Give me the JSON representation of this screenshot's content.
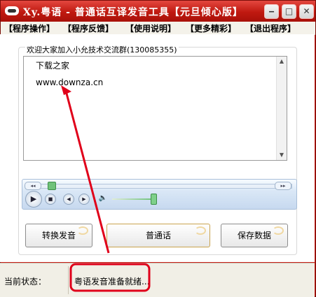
{
  "window": {
    "title": "Xy.粤语 - 普通话互译发音工具【元旦倾心版】",
    "minimize": "‒",
    "maximize": "□",
    "close": "✕"
  },
  "menu": {
    "items": [
      {
        "label": "【程序操作】"
      },
      {
        "label": "【程序反馈】"
      },
      {
        "label": "【使用说明】"
      },
      {
        "label": "【更多精彩】"
      },
      {
        "label": "【退出程序】"
      }
    ]
  },
  "main": {
    "group_title": "欢迎大家加入小允技术交流群(130085355)",
    "text_lines": [
      "下载之家",
      "www.downza.cn"
    ]
  },
  "player": {
    "seek_position": 0.08,
    "volume_level": 1.0,
    "left_mini": "◂◂",
    "right_mini": "▸▸",
    "play": "▶",
    "stop": "■",
    "prev": "◀",
    "next": "▶",
    "speaker": "🔈"
  },
  "buttons": {
    "convert": "转换发音",
    "mandarin": "普通话",
    "save": "保存数据"
  },
  "status": {
    "label": "当前状态：",
    "value": "粤语发音准备就绪..."
  },
  "colors": {
    "titlebar": "#c81e16",
    "annotation": "#e0001a"
  }
}
